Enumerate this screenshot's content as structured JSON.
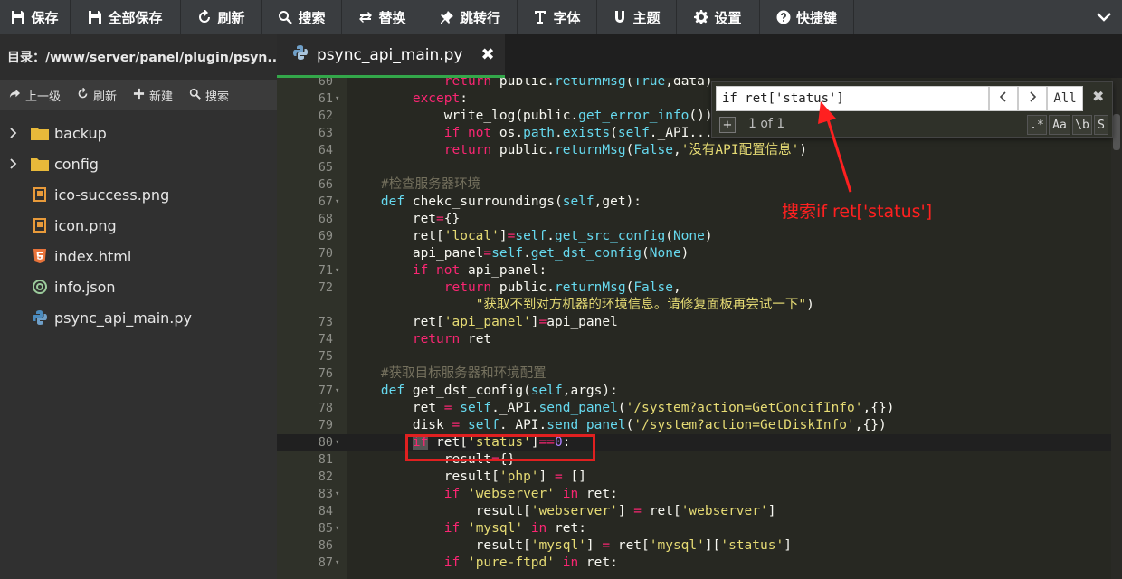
{
  "toolbar": {
    "items": [
      {
        "label": "保存",
        "icon": "save-icon"
      },
      {
        "label": "全部保存",
        "icon": "save-all-icon"
      },
      {
        "label": "刷新",
        "icon": "refresh-icon"
      },
      {
        "label": "搜索",
        "icon": "search-icon"
      },
      {
        "label": "替换",
        "icon": "replace-icon"
      },
      {
        "label": "跳转行",
        "icon": "pin-icon"
      },
      {
        "label": "字体",
        "icon": "font-icon"
      },
      {
        "label": "主题",
        "icon": "theme-icon"
      },
      {
        "label": "设置",
        "icon": "gear-icon"
      },
      {
        "label": "快捷键",
        "icon": "question-icon"
      }
    ]
  },
  "sidebar": {
    "directory": "目录：/www/server/panel/plugin/psyn...",
    "tools": {
      "up": "上一级",
      "refresh": "刷新",
      "new": "新建",
      "search": "搜索"
    },
    "files": [
      {
        "name": "backup",
        "type": "folder"
      },
      {
        "name": "config",
        "type": "folder"
      },
      {
        "name": "ico-success.png",
        "type": "image"
      },
      {
        "name": "icon.png",
        "type": "image"
      },
      {
        "name": "index.html",
        "type": "html"
      },
      {
        "name": "info.json",
        "type": "json"
      },
      {
        "name": "psync_api_main.py",
        "type": "python"
      }
    ]
  },
  "editor": {
    "tab_title": "psync_api_main.py",
    "current_line": 80
  },
  "search": {
    "value": "if ret['status']",
    "prev": "<",
    "next": ">",
    "all": "All",
    "count": "1 of 1",
    "plus": "+",
    "options": [
      ".*",
      "Aa",
      "\\b",
      "S"
    ]
  },
  "annotation": {
    "label": "搜索if ret['status']",
    "color": "#ff2020"
  },
  "colors": {
    "keyword": "#f92672",
    "string": "#e6db74",
    "builtin": "#66d9ef",
    "comment": "#75715e",
    "tab_accent": "#33a74a"
  }
}
